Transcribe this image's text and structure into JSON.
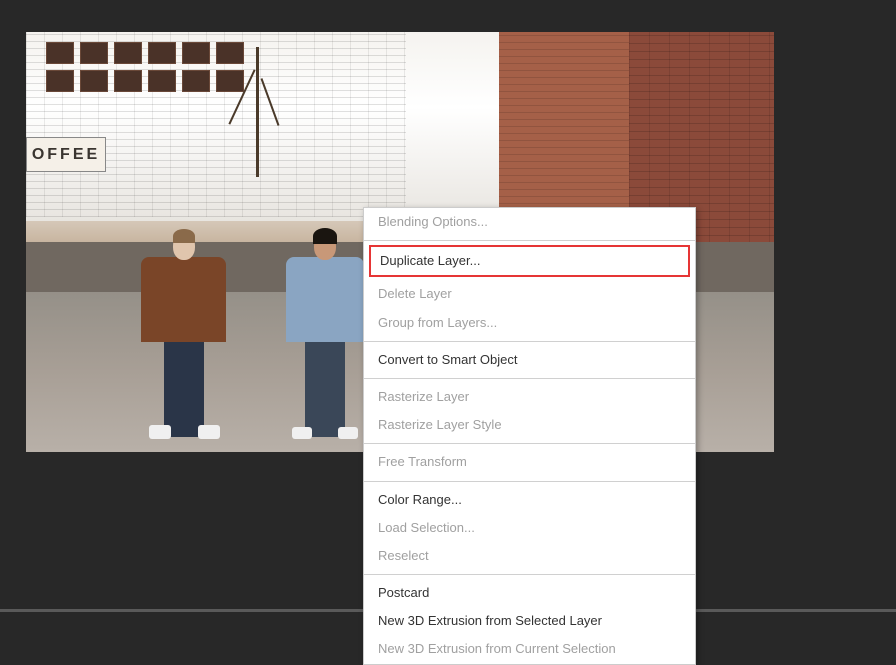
{
  "coffee_sign": "OFFEE",
  "context_menu": {
    "items": [
      {
        "label": "Blending Options...",
        "enabled": false,
        "highlighted": false
      },
      {
        "separator": true
      },
      {
        "label": "Duplicate Layer...",
        "enabled": true,
        "highlighted": true
      },
      {
        "label": "Delete Layer",
        "enabled": false,
        "highlighted": false
      },
      {
        "label": "Group from Layers...",
        "enabled": false,
        "highlighted": false
      },
      {
        "separator": true
      },
      {
        "label": "Convert to Smart Object",
        "enabled": true,
        "highlighted": false
      },
      {
        "separator": true
      },
      {
        "label": "Rasterize Layer",
        "enabled": false,
        "highlighted": false
      },
      {
        "label": "Rasterize Layer Style",
        "enabled": false,
        "highlighted": false
      },
      {
        "separator": true
      },
      {
        "label": "Free Transform",
        "enabled": false,
        "highlighted": false
      },
      {
        "separator": true
      },
      {
        "label": "Color Range...",
        "enabled": true,
        "highlighted": false
      },
      {
        "label": "Load Selection...",
        "enabled": false,
        "highlighted": false
      },
      {
        "label": "Reselect",
        "enabled": false,
        "highlighted": false
      },
      {
        "separator": true
      },
      {
        "label": "Postcard",
        "enabled": true,
        "highlighted": false
      },
      {
        "label": "New 3D Extrusion from Selected Layer",
        "enabled": true,
        "highlighted": false
      },
      {
        "label": "New 3D Extrusion from Current Selection",
        "enabled": false,
        "highlighted": false
      }
    ]
  }
}
